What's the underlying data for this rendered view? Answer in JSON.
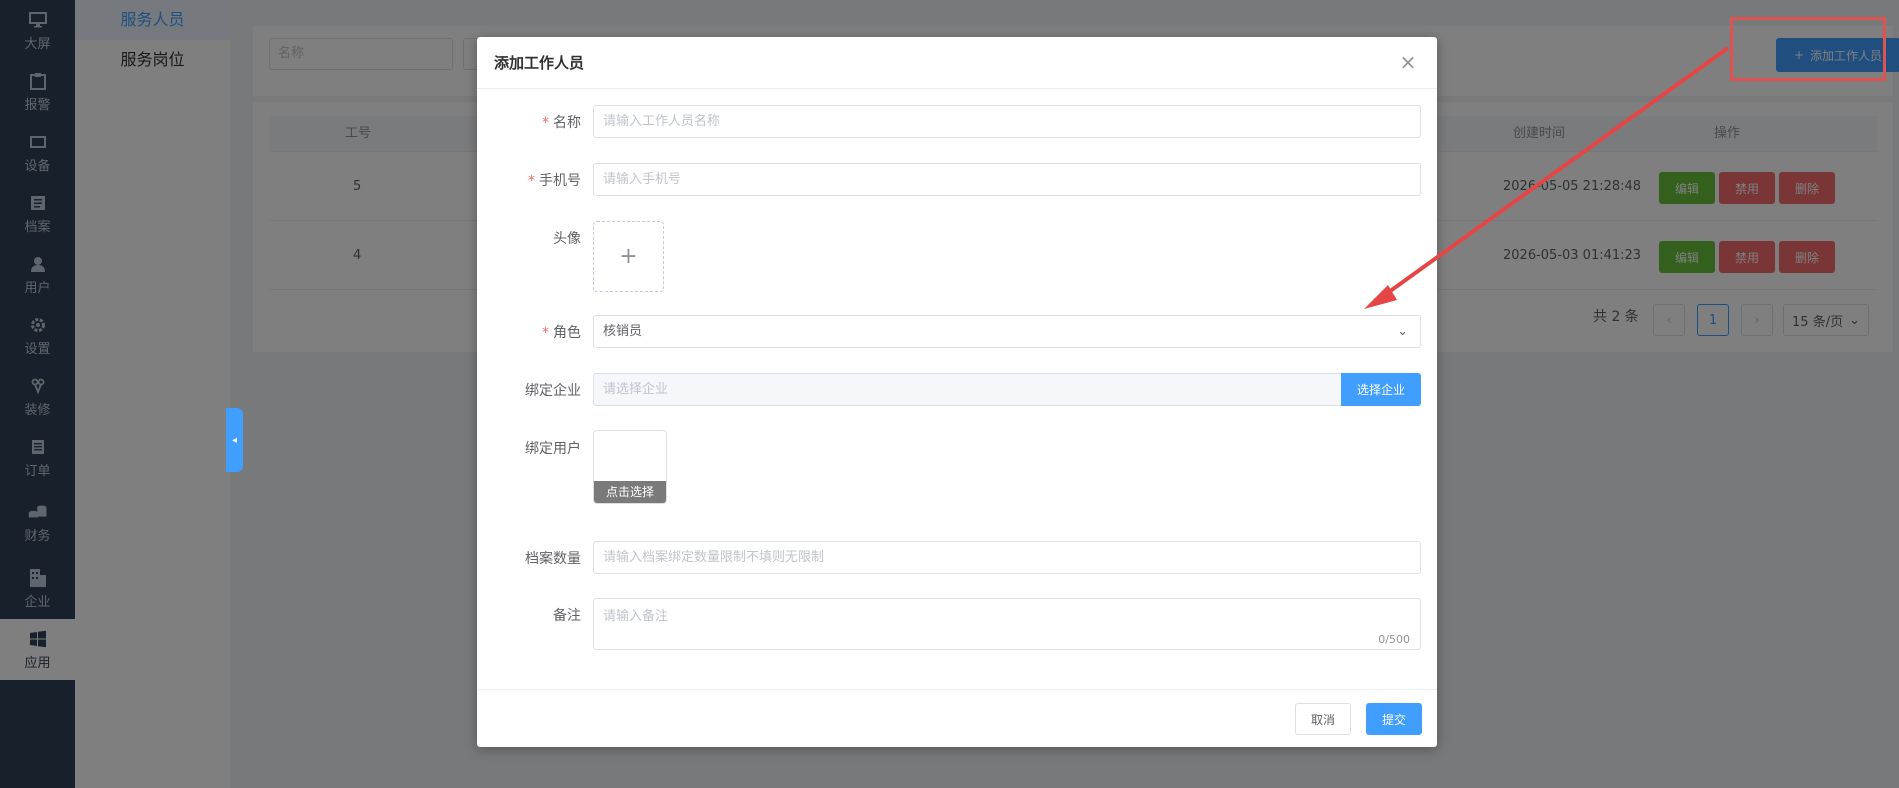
{
  "sidebar": {
    "items": [
      {
        "label": "大屏",
        "icon": "monitor-icon"
      },
      {
        "label": "报警",
        "icon": "clipboard-icon"
      },
      {
        "label": "设备",
        "icon": "device-icon"
      },
      {
        "label": "档案",
        "icon": "archive-icon"
      },
      {
        "label": "用户",
        "icon": "user-icon"
      },
      {
        "label": "设置",
        "icon": "gear-icon"
      },
      {
        "label": "装修",
        "icon": "wrench-icon"
      },
      {
        "label": "订单",
        "icon": "order-icon"
      },
      {
        "label": "财务",
        "icon": "coins-icon"
      },
      {
        "label": "企业",
        "icon": "building-icon"
      },
      {
        "label": "应用",
        "icon": "windows-icon"
      }
    ]
  },
  "submenu": {
    "items": [
      "服务人员",
      "服务岗位"
    ]
  },
  "search": {
    "name_placeholder": "名称"
  },
  "toolbar": {
    "add_label": "添加工作人员"
  },
  "table": {
    "headers": {
      "id": "工号",
      "created": "创建时间",
      "ops": "操作"
    },
    "rows": [
      {
        "id": "5",
        "created": "2026-05-05 21:28:48"
      },
      {
        "id": "4",
        "created": "2026-05-03 01:41:23"
      }
    ],
    "op_labels": {
      "edit": "编辑",
      "disable": "禁用",
      "delete": "删除"
    },
    "pagination": {
      "total": "共 2 条",
      "page": "1",
      "size": "15 条/页"
    }
  },
  "dialog": {
    "title": "添加工作人员",
    "fields": {
      "name": {
        "label": "名称",
        "placeholder": "请输入工作人员名称"
      },
      "phone": {
        "label": "手机号",
        "placeholder": "请输入手机号"
      },
      "avatar": {
        "label": "头像",
        "plus": "+"
      },
      "role": {
        "label": "角色",
        "value": "核销员"
      },
      "enterprise": {
        "label": "绑定企业",
        "placeholder": "请选择企业",
        "button": "选择企业"
      },
      "user": {
        "label": "绑定用户",
        "button": "点击选择"
      },
      "archive_count": {
        "label": "档案数量",
        "placeholder": "请输入档案绑定数量限制不填则无限制"
      },
      "remark": {
        "label": "备注",
        "placeholder": "请输入备注",
        "counter": "0/500"
      }
    },
    "footer": {
      "cancel": "取消",
      "submit": "提交"
    }
  },
  "colors": {
    "primary": "#409eff",
    "danger": "#f56c6c",
    "success": "#67c23a",
    "annotation": "#e05252"
  }
}
